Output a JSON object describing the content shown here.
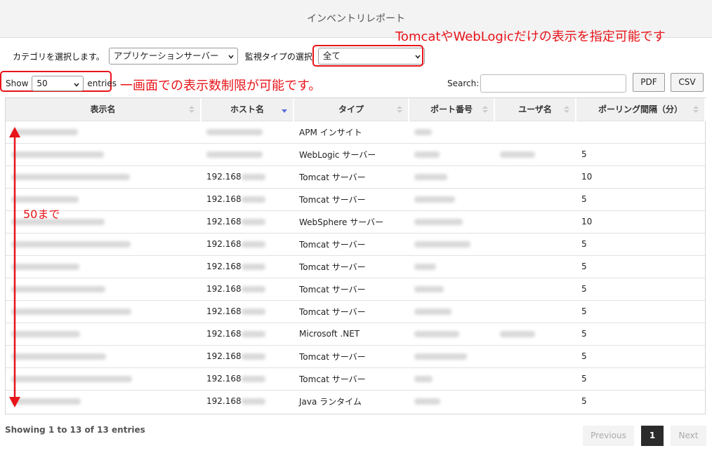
{
  "header": {
    "title": "インベントリレポート"
  },
  "filters": {
    "category_label": "カテゴリを選択します。",
    "category_value": "アプリケーションサーバー",
    "type_label": "監視タイプの選択",
    "type_value": "全て"
  },
  "annotations": {
    "type_note": "TomcatやWebLogicだけの表示を指定可能です",
    "show_note": "一画面での表示数制限が可能です。",
    "rows_note": "50まで"
  },
  "length": {
    "show_label": "Show",
    "value": "50",
    "entries_label": "entries"
  },
  "search": {
    "label": "Search:"
  },
  "buttons": {
    "pdf": "PDF",
    "csv": "CSV"
  },
  "table": {
    "columns": [
      "表示名",
      "ホスト名",
      "タイプ",
      "ポート番号",
      "ユーザ名",
      "ポーリング間隔（分）"
    ],
    "rows": [
      {
        "host": "",
        "type": "APM インサイト",
        "interval": ""
      },
      {
        "host": "",
        "type": "WebLogic サーバー",
        "interval": "5"
      },
      {
        "host": "192.168",
        "type": "Tomcat サーバー",
        "interval": "10"
      },
      {
        "host": "192.168",
        "type": "Tomcat サーバー",
        "interval": "5"
      },
      {
        "host": "192.168",
        "type": "WebSphere サーバー",
        "interval": "10"
      },
      {
        "host": "192.168",
        "type": "Tomcat サーバー",
        "interval": "5"
      },
      {
        "host": "192.168",
        "type": "Tomcat サーバー",
        "interval": "5"
      },
      {
        "host": "192.168",
        "type": "Tomcat サーバー",
        "interval": "5"
      },
      {
        "host": "192.168",
        "type": "Tomcat サーバー",
        "interval": "5"
      },
      {
        "host": "192.168",
        "type": "Microsoft .NET",
        "interval": "5"
      },
      {
        "host": "192.168",
        "type": "Tomcat サーバー",
        "interval": "5"
      },
      {
        "host": "192.168",
        "type": "Tomcat サーバー",
        "interval": "5"
      },
      {
        "host": "192.168",
        "type": "Java ランタイム",
        "interval": "5"
      }
    ]
  },
  "footer": {
    "info": "Showing 1 to 13 of 13 entries",
    "prev": "Previous",
    "page": "1",
    "next": "Next"
  },
  "colors": {
    "annotation": "#e8141a",
    "sort_active": "#5b6fd6",
    "page_active": "#2b2b2b"
  },
  "icons": {
    "sort": "sort-both-icon",
    "sort_active": "sort-desc-icon",
    "caret": "chevron-down-icon"
  }
}
